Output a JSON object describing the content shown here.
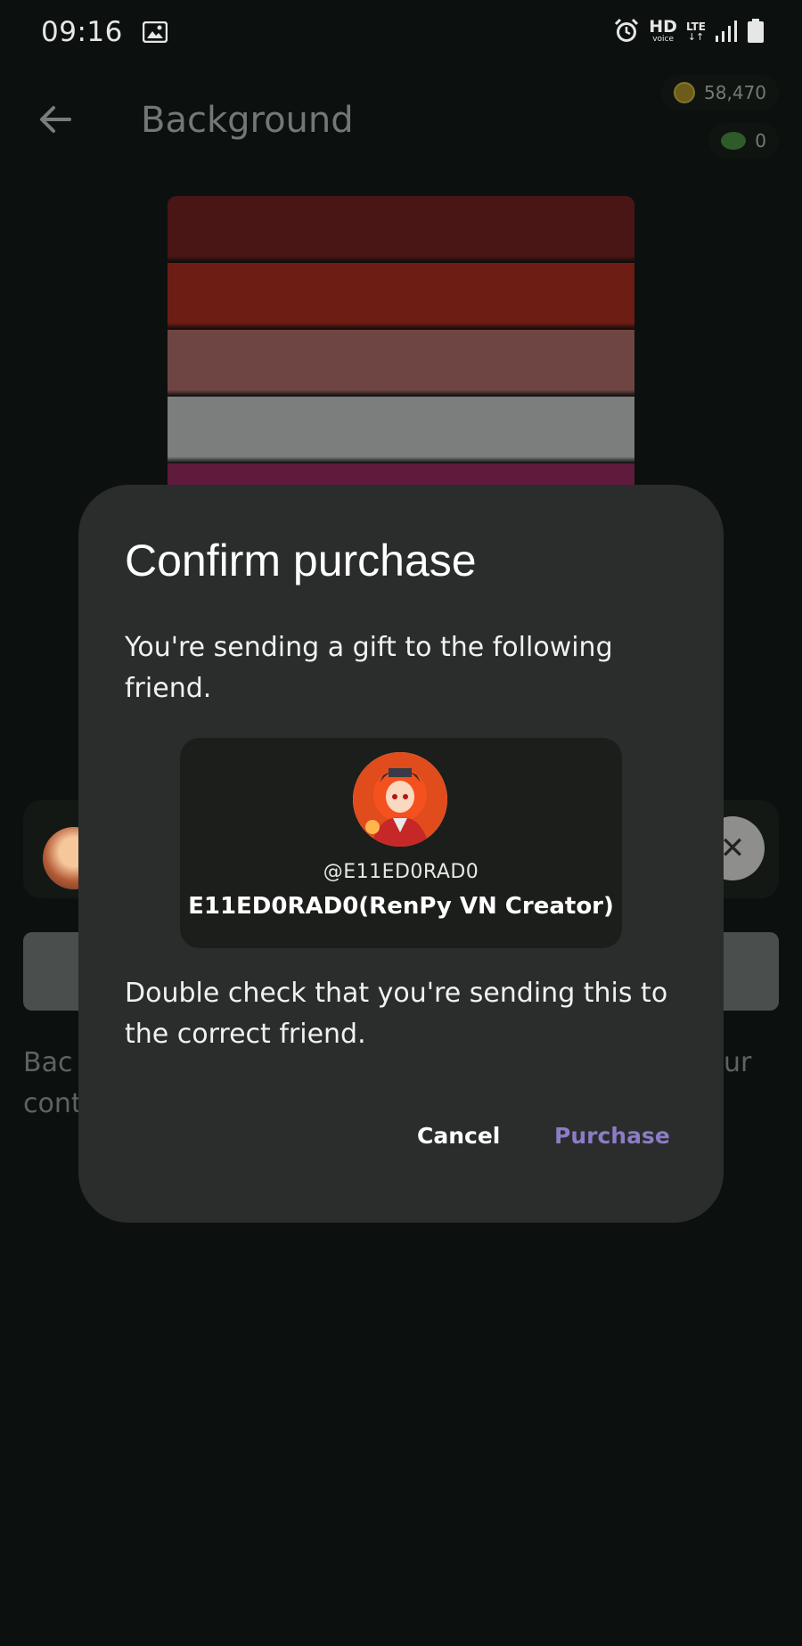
{
  "status_bar": {
    "time": "09:16",
    "hd_label": "HD",
    "voice_label": "voice",
    "lte_label": "LTE",
    "lte_arrows": "↓↑"
  },
  "header": {
    "title": "Background",
    "coins": "58,470",
    "gems": "0"
  },
  "preview": {
    "stripe_colors": [
      "#4a1515",
      "#6e1d14",
      "#6f4543",
      "#7c7d7d",
      "#5e1b3c"
    ]
  },
  "page": {
    "desc_left_line1": "Bac",
    "desc_left_line2": "cont",
    "desc_right_line1": "ur"
  },
  "dialog": {
    "title": "Confirm purchase",
    "intro": "You're sending a gift to the following friend.",
    "friend": {
      "handle": "@E11ED0RAD0",
      "name": "E11ED0RAD0(RenPy VN Creator)"
    },
    "warning": "Double check that you're sending this to the correct friend.",
    "cancel_label": "Cancel",
    "purchase_label": "Purchase"
  },
  "colors": {
    "accent": "#8c7cc6",
    "dialog_bg": "#2a2d2c"
  }
}
